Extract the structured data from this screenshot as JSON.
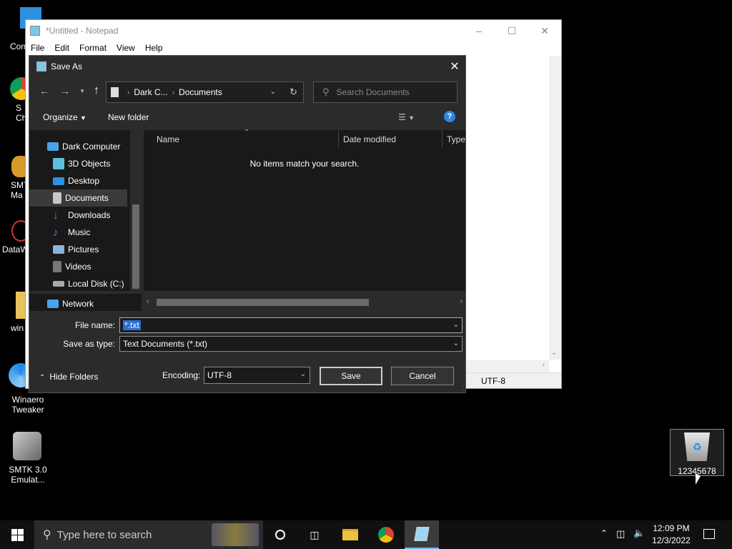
{
  "desktop": {
    "icons": [
      {
        "label": "D Con"
      },
      {
        "label": "S\nChi"
      },
      {
        "label": "SMT\nMa"
      },
      {
        "label": "DataW"
      },
      {
        "label": "win"
      },
      {
        "label": "Winaero\nTweaker"
      },
      {
        "label": "SMTK 3.0\nEmulat..."
      }
    ],
    "recycle_bin_label": "12345678"
  },
  "notepad": {
    "title": "*Untitled - Notepad",
    "menu": [
      "File",
      "Edit",
      "Format",
      "View",
      "Help"
    ],
    "status_encoding": "UTF-8"
  },
  "dialog": {
    "title": "Save As",
    "address": {
      "crumb1": "Dark C...",
      "crumb2": "Documents"
    },
    "search_placeholder": "Search Documents",
    "organize_label": "Organize",
    "new_folder_label": "New folder",
    "nav_items": [
      {
        "label": "Dark Computer",
        "icon": "computer-icon",
        "color": "#4aa3e8"
      },
      {
        "label": "3D Objects",
        "icon": "cube-icon",
        "color": "#5bc0de"
      },
      {
        "label": "Desktop",
        "icon": "desktop-icon",
        "color": "#2f8fe0"
      },
      {
        "label": "Documents",
        "icon": "document-icon",
        "color": "#c8c8c8"
      },
      {
        "label": "Downloads",
        "icon": "download-icon",
        "color": "#3a8ee6"
      },
      {
        "label": "Music",
        "icon": "music-icon",
        "color": "#3a8ee6"
      },
      {
        "label": "Pictures",
        "icon": "picture-icon",
        "color": "#8ab4d8"
      },
      {
        "label": "Videos",
        "icon": "video-icon",
        "color": "#777"
      },
      {
        "label": "Local Disk (C:)",
        "icon": "disk-icon",
        "color": "#aaa"
      },
      {
        "label": "Network",
        "icon": "network-icon",
        "color": "#4aa3e8"
      }
    ],
    "columns": [
      "Name",
      "Date modified",
      "Type"
    ],
    "empty_message": "No items match your search.",
    "file_name_label": "File name:",
    "file_name_value": "*.txt",
    "save_type_label": "Save as type:",
    "save_type_value": "Text Documents (*.txt)",
    "hide_folders_label": "Hide Folders",
    "encoding_label": "Encoding:",
    "encoding_value": "UTF-8",
    "save_label": "Save",
    "cancel_label": "Cancel"
  },
  "taskbar": {
    "search_placeholder": "Type here to search",
    "time": "12:09 PM",
    "date": "12/3/2022"
  }
}
